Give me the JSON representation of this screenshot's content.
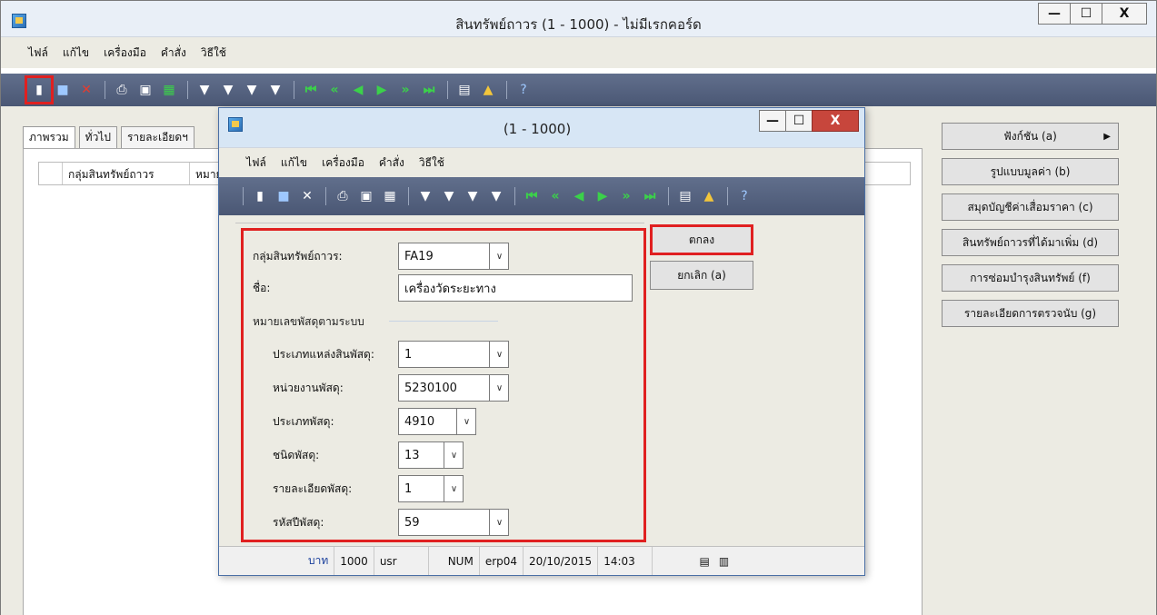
{
  "main": {
    "title": "สินทรัพย์ถาวร (1 - 1000) - ไม่มีเรกคอร์ด",
    "window_buttons": {
      "minimize": "—",
      "maximize": "☐",
      "close": "X"
    },
    "menu": [
      "ไฟล์",
      "แก้ไข",
      "เครื่องมือ",
      "คำสั่ง",
      "วิธีใช้"
    ],
    "tabs": [
      "ภาพรวม",
      "ทั่วไป",
      "รายละเอียดฯ"
    ],
    "grid_columns": [
      "",
      "กลุ่มสินทรัพย์ถาวร",
      "หมายเ"
    ],
    "side_buttons": [
      {
        "label": "ฟังก์ชัน (a)",
        "has_arrow": true
      },
      {
        "label": "รูปแบบมูลค่า (b)"
      },
      {
        "label": "สมุดบัญชีค่าเสื่อมราคา (c)"
      },
      {
        "label": "สินทรัพย์ถาวรที่ได้มาเพิ่ม (d)"
      },
      {
        "label": "การซ่อมบำรุงสินทรัพย์ (f)"
      },
      {
        "label": "รายละเอียดการตรวจนับ (g)"
      }
    ],
    "arrow_glyph": "▶"
  },
  "dialog": {
    "title": "(1 - 1000)",
    "window_buttons": {
      "minimize": "—",
      "maximize": "☐",
      "close": "X"
    },
    "menu": [
      "ไฟล์",
      "แก้ไข",
      "เครื่องมือ",
      "คำสั่ง",
      "วิธีใช้"
    ],
    "fields": {
      "asset_group": {
        "label": "กลุ่มสินทรัพย์ถาวร:",
        "value": "FA19"
      },
      "name": {
        "label": "ชื่อ:",
        "value": "เครื่องวัดระยะทาง"
      },
      "section": "หมายเลขพัสดุตามระบบ",
      "source_type": {
        "label": "ประเภทแหล่งสินพัสดุ:",
        "value": "1"
      },
      "unit": {
        "label": "หน่วยงานพัสดุ:",
        "value": "5230100"
      },
      "item_type": {
        "label": "ประเภทพัสดุ:",
        "value": "4910"
      },
      "item_kind": {
        "label": "ชนิดพัสดุ:",
        "value": "13"
      },
      "item_detail": {
        "label": "รายละเอียดพัสดุ:",
        "value": "1"
      },
      "year_code": {
        "label": "รหัสปีพัสดุ:",
        "value": "59"
      }
    },
    "buttons": {
      "ok": "ตกลง",
      "cancel": "ยกเลิก (a)"
    },
    "status": {
      "currency": "บาท",
      "company": "1000",
      "user": "usr",
      "numlock": "NUM",
      "server": "erp04",
      "date": "20/10/2015",
      "time": "14:03"
    }
  },
  "icons": {
    "dropdown": "∨",
    "toolbar_main": [
      "new-icon",
      "save-icon",
      "delete-icon",
      "sep",
      "print-icon",
      "print-preview-icon",
      "export-excel-icon",
      "sep",
      "filter-icon",
      "filter-advanced-icon",
      "filter-selection-icon",
      "filter-clear-icon",
      "sep",
      "first-record-icon",
      "previous-page-icon",
      "previous-record-icon",
      "next-record-icon",
      "next-page-icon",
      "last-record-icon",
      "sep",
      "attachment-icon",
      "alert-icon",
      "sep",
      "help-icon"
    ]
  },
  "colors": {
    "highlight": "#e02020",
    "toolbar": "#55627f",
    "ok_border": "#e02020"
  }
}
